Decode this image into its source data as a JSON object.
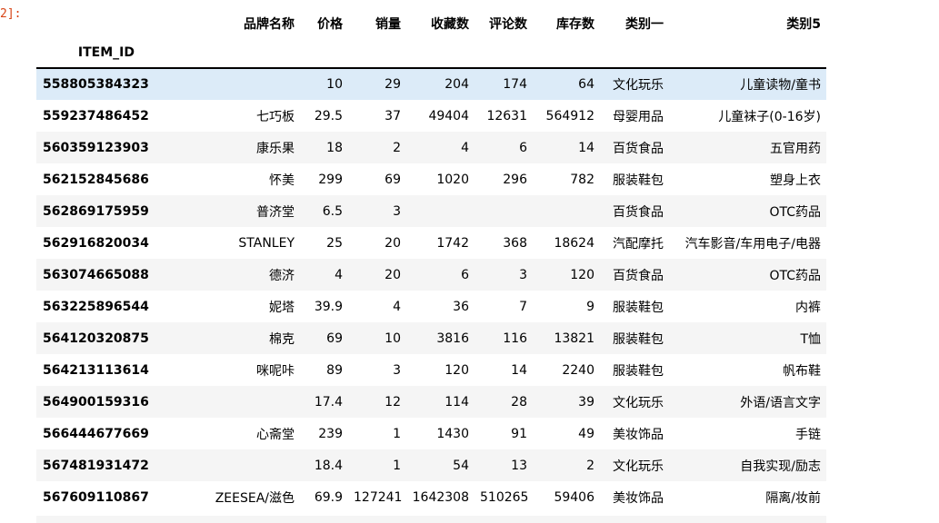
{
  "prompt": "2]:",
  "table": {
    "columns": [
      "品牌名称",
      "价格",
      "销量",
      "收藏数",
      "评论数",
      "库存数",
      "类别一",
      "类别5"
    ],
    "index_name": "ITEM_ID",
    "rows": [
      {
        "id": "558805384323",
        "cells": [
          "",
          "10",
          "29",
          "204",
          "174",
          "64",
          "文化玩乐",
          "儿童读物/童书"
        ]
      },
      {
        "id": "559237486452",
        "cells": [
          "七巧板",
          "29.5",
          "37",
          "49404",
          "12631",
          "564912",
          "母婴用品",
          "儿童袜子(0-16岁)"
        ]
      },
      {
        "id": "560359123903",
        "cells": [
          "康乐果",
          "18",
          "2",
          "4",
          "6",
          "14",
          "百货食品",
          "五官用药"
        ]
      },
      {
        "id": "562152845686",
        "cells": [
          "怀美",
          "299",
          "69",
          "1020",
          "296",
          "782",
          "服装鞋包",
          "塑身上衣"
        ]
      },
      {
        "id": "562869175959",
        "cells": [
          "普济堂",
          "6.5",
          "3",
          "",
          "",
          "",
          "百货食品",
          "OTC药品"
        ]
      },
      {
        "id": "562916820034",
        "cells": [
          "STANLEY",
          "25",
          "20",
          "1742",
          "368",
          "18624",
          "汽配摩托",
          "汽车影音/车用电子/电器"
        ]
      },
      {
        "id": "563074665088",
        "cells": [
          "德济",
          "4",
          "20",
          "6",
          "3",
          "120",
          "百货食品",
          "OTC药品"
        ]
      },
      {
        "id": "563225896544",
        "cells": [
          "妮塔",
          "39.9",
          "4",
          "36",
          "7",
          "9",
          "服装鞋包",
          "内裤"
        ]
      },
      {
        "id": "564120320875",
        "cells": [
          "棉克",
          "69",
          "10",
          "3816",
          "116",
          "13821",
          "服装鞋包",
          "T恤"
        ]
      },
      {
        "id": "564213113614",
        "cells": [
          "咪呢咔",
          "89",
          "3",
          "120",
          "14",
          "2240",
          "服装鞋包",
          "帆布鞋"
        ]
      },
      {
        "id": "564900159316",
        "cells": [
          "",
          "17.4",
          "12",
          "114",
          "28",
          "39",
          "文化玩乐",
          "外语/语言文字"
        ]
      },
      {
        "id": "566444677669",
        "cells": [
          "心斋堂",
          "239",
          "1",
          "1430",
          "91",
          "49",
          "美妆饰品",
          "手链"
        ]
      },
      {
        "id": "567481931472",
        "cells": [
          "",
          "18.4",
          "1",
          "54",
          "13",
          "2",
          "文化玩乐",
          "自我实现/励志"
        ]
      },
      {
        "id": "567609110867",
        "cells": [
          "ZEESEA/滋色",
          "69.9",
          "127241",
          "1642308",
          "510265",
          "59406",
          "美妆饰品",
          "隔离/妆前"
        ]
      }
    ],
    "highlighted_row": 0
  },
  "colors": {
    "highlight": "#dcebf8",
    "stripe": "#f5f5f5",
    "prompt": "#d84315"
  }
}
